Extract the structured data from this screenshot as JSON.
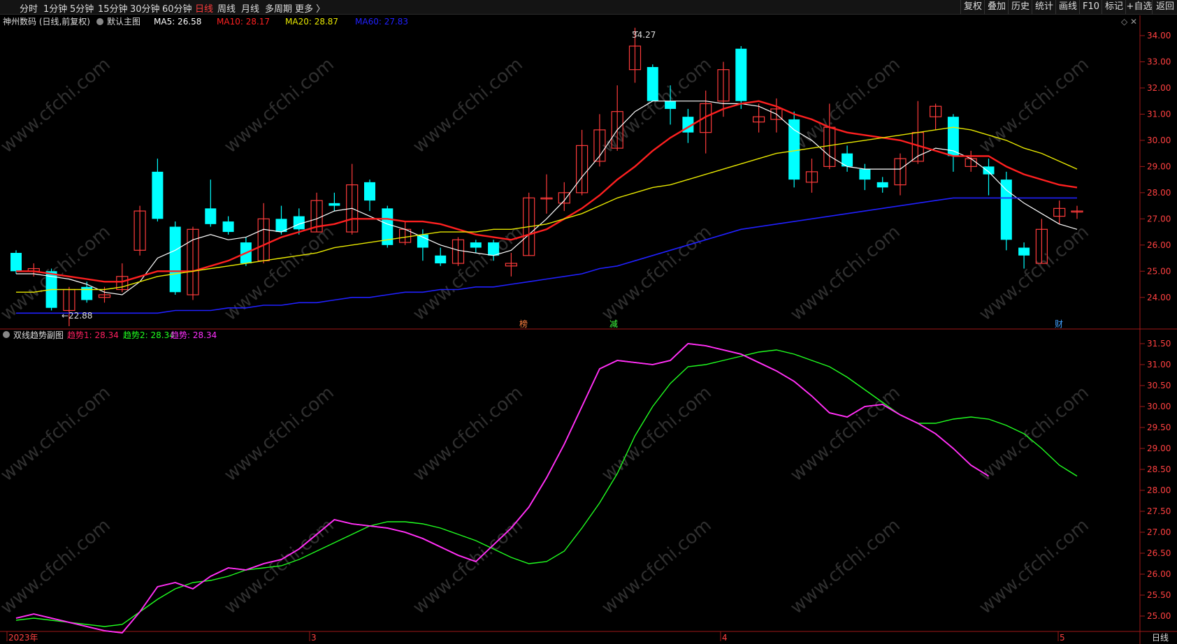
{
  "topbar": {
    "left_items": [
      "分时",
      "1分钟",
      "5分钟",
      "15分钟",
      "30分钟",
      "60分钟",
      "日线",
      "周线",
      "月线",
      "多周期",
      "更多 〉"
    ],
    "active": "日线",
    "right_items": [
      "复权",
      "叠加",
      "历史",
      "统计",
      "画线",
      "F10",
      "标记",
      "+自选",
      "返回"
    ]
  },
  "main_header": {
    "stock": "神州数码 (日线,前复权)",
    "indicator": "默认主图",
    "ma5": "MA5: 26.58",
    "ma10": "MA10: 28.17",
    "ma20": "MA20: 28.87",
    "ma60": "MA60: 27.83"
  },
  "sub_header": {
    "name": "双线趋势副图",
    "t1": "趋势1: 28.34",
    "t2": "趋势2: 28.34",
    "t3": "趋势: 28.34"
  },
  "annotations": {
    "high": "34.27",
    "low": "22.88",
    "markers": [
      "榜",
      "减",
      "财"
    ]
  },
  "date_labels": [
    "2023年",
    "3",
    "4",
    "5"
  ],
  "period_label": "日线",
  "watermark": "www.cfchi.com",
  "colors": {
    "up": "#ff3b3b",
    "down": "#00ffff",
    "ma5": "#ffffff",
    "ma10": "#ff2020",
    "ma20": "#e8e800",
    "ma60": "#2020ff",
    "trend1": "#ff2060",
    "trend2": "#20ff20",
    "trend": "#ff30ff"
  },
  "chart_data": [
    {
      "type": "candlestick",
      "title": "神州数码 (日线,前复权)",
      "ylim": [
        23.3,
        34.4
      ],
      "yticks": [
        24.0,
        25.0,
        26.0,
        27.0,
        28.0,
        29.0,
        30.0,
        31.0,
        32.0,
        33.0,
        34.0
      ],
      "candles": [
        [
          25.7,
          25.0,
          25.8,
          24.9
        ],
        [
          25.0,
          25.1,
          25.3,
          24.8
        ],
        [
          25.0,
          23.6,
          25.1,
          23.5
        ],
        [
          23.5,
          24.3,
          24.4,
          22.9
        ],
        [
          24.4,
          23.9,
          24.6,
          23.8
        ],
        [
          24.0,
          24.1,
          24.4,
          23.8
        ],
        [
          24.3,
          24.8,
          25.3,
          24.2
        ],
        [
          25.8,
          27.3,
          27.5,
          25.6
        ],
        [
          28.8,
          27.0,
          29.3,
          26.9
        ],
        [
          26.7,
          24.2,
          26.9,
          24.1
        ],
        [
          24.1,
          26.6,
          26.7,
          23.9
        ],
        [
          27.4,
          26.8,
          28.5,
          26.7
        ],
        [
          26.9,
          26.5,
          27.1,
          26.4
        ],
        [
          26.1,
          25.3,
          26.3,
          25.2
        ],
        [
          25.4,
          27.0,
          27.6,
          25.3
        ],
        [
          27.0,
          26.5,
          27.5,
          26.4
        ],
        [
          27.1,
          26.6,
          27.4,
          26.4
        ],
        [
          26.5,
          27.7,
          28.0,
          26.5
        ],
        [
          27.6,
          27.5,
          28.0,
          27.3
        ],
        [
          26.5,
          28.3,
          29.1,
          26.4
        ],
        [
          28.4,
          27.7,
          28.5,
          27.3
        ],
        [
          27.4,
          26.0,
          27.5,
          25.9
        ],
        [
          26.1,
          26.6,
          26.9,
          26.0
        ],
        [
          26.4,
          25.9,
          26.6,
          25.4
        ],
        [
          25.6,
          25.3,
          25.9,
          25.2
        ],
        [
          25.3,
          26.2,
          26.3,
          25.2
        ],
        [
          26.1,
          25.9,
          26.2,
          25.7
        ],
        [
          26.1,
          25.6,
          26.2,
          25.4
        ],
        [
          25.2,
          25.3,
          25.7,
          24.8
        ],
        [
          25.6,
          27.8,
          28.0,
          25.6
        ],
        [
          27.8,
          27.8,
          28.7,
          27.2
        ],
        [
          27.6,
          28.0,
          28.4,
          27.3
        ],
        [
          28.0,
          29.8,
          30.4,
          27.9
        ],
        [
          29.2,
          30.4,
          31.0,
          29.0
        ],
        [
          29.7,
          31.1,
          32.1,
          29.6
        ],
        [
          32.7,
          33.6,
          34.3,
          32.2
        ],
        [
          32.8,
          31.5,
          32.9,
          31.5
        ],
        [
          31.5,
          31.2,
          32.1,
          30.6
        ],
        [
          30.9,
          30.3,
          31.2,
          29.9
        ],
        [
          30.3,
          31.4,
          31.9,
          29.5
        ],
        [
          31.5,
          32.7,
          33.0,
          30.9
        ],
        [
          33.5,
          31.5,
          33.6,
          31.2
        ],
        [
          30.7,
          30.9,
          31.4,
          30.3
        ],
        [
          30.8,
          31.2,
          31.6,
          30.3
        ],
        [
          30.8,
          28.5,
          31.1,
          28.2
        ],
        [
          28.4,
          28.8,
          29.3,
          28.0
        ],
        [
          29.0,
          30.5,
          31.4,
          28.9
        ],
        [
          29.5,
          29.0,
          29.8,
          28.8
        ],
        [
          28.9,
          28.5,
          29.1,
          28.1
        ],
        [
          28.4,
          28.2,
          28.6,
          28.0
        ],
        [
          28.3,
          29.3,
          29.5,
          27.9
        ],
        [
          29.2,
          30.3,
          31.5,
          29.1
        ],
        [
          30.9,
          31.3,
          31.4,
          30.4
        ],
        [
          30.9,
          29.4,
          31.0,
          28.8
        ],
        [
          29.0,
          29.3,
          29.6,
          28.8
        ],
        [
          29.0,
          28.7,
          29.3,
          27.9
        ],
        [
          28.5,
          26.2,
          28.8,
          25.8
        ],
        [
          25.9,
          25.6,
          26.1,
          25.1
        ],
        [
          25.3,
          26.6,
          27.0,
          25.3
        ],
        [
          27.1,
          27.4,
          27.7,
          26.8
        ],
        [
          27.3,
          27.3,
          27.5,
          27.0
        ]
      ],
      "series": [
        {
          "name": "MA5",
          "values": [
            24.9,
            24.9,
            24.8,
            24.7,
            24.5,
            24.2,
            24.1,
            24.6,
            25.5,
            25.8,
            26.2,
            26.4,
            26.2,
            26.3,
            26.6,
            26.5,
            26.8,
            27.0,
            27.3,
            27.4,
            27.1,
            26.8,
            26.6,
            26.3,
            26.0,
            25.8,
            25.7,
            25.6,
            25.8,
            26.4,
            27.0,
            27.7,
            28.6,
            29.4,
            30.4,
            31.1,
            31.5,
            31.5,
            31.5,
            31.5,
            31.4,
            31.4,
            31.3,
            31.0,
            30.4,
            30.0,
            29.4,
            29.0,
            28.9,
            28.9,
            28.9,
            29.4,
            29.7,
            29.6,
            29.3,
            28.8,
            28.1,
            27.6,
            27.2,
            26.8,
            26.6
          ]
        },
        {
          "name": "MA10",
          "values": [
            25.0,
            25.0,
            24.9,
            24.8,
            24.7,
            24.6,
            24.6,
            24.8,
            25.0,
            25.0,
            25.0,
            25.2,
            25.4,
            25.7,
            26.0,
            26.3,
            26.5,
            26.7,
            26.8,
            27.0,
            27.0,
            27.0,
            26.9,
            26.9,
            26.8,
            26.6,
            26.4,
            26.3,
            26.2,
            26.4,
            26.6,
            27.0,
            27.4,
            27.9,
            28.5,
            29.0,
            29.6,
            30.1,
            30.5,
            30.9,
            31.2,
            31.4,
            31.5,
            31.3,
            31.0,
            30.8,
            30.5,
            30.3,
            30.2,
            30.1,
            30.0,
            29.8,
            29.6,
            29.4,
            29.4,
            29.4,
            29.0,
            28.7,
            28.5,
            28.3,
            28.2
          ]
        },
        {
          "name": "MA20",
          "values": [
            24.2,
            24.2,
            24.3,
            24.3,
            24.3,
            24.3,
            24.4,
            24.6,
            24.8,
            24.9,
            25.0,
            25.1,
            25.2,
            25.3,
            25.4,
            25.5,
            25.6,
            25.7,
            25.9,
            26.0,
            26.1,
            26.2,
            26.3,
            26.4,
            26.5,
            26.5,
            26.5,
            26.6,
            26.6,
            26.7,
            26.8,
            27.0,
            27.2,
            27.5,
            27.8,
            28.0,
            28.2,
            28.3,
            28.5,
            28.7,
            28.9,
            29.1,
            29.3,
            29.5,
            29.6,
            29.7,
            29.8,
            29.9,
            30.0,
            30.1,
            30.2,
            30.3,
            30.4,
            30.5,
            30.4,
            30.2,
            30.0,
            29.7,
            29.5,
            29.2,
            28.9
          ]
        },
        {
          "name": "MA60",
          "values": [
            23.4,
            23.4,
            23.4,
            23.4,
            23.4,
            23.4,
            23.4,
            23.4,
            23.4,
            23.5,
            23.5,
            23.5,
            23.6,
            23.6,
            23.7,
            23.7,
            23.8,
            23.8,
            23.9,
            24.0,
            24.0,
            24.1,
            24.2,
            24.2,
            24.3,
            24.3,
            24.4,
            24.4,
            24.5,
            24.6,
            24.7,
            24.8,
            24.9,
            25.1,
            25.2,
            25.4,
            25.6,
            25.8,
            26.0,
            26.2,
            26.4,
            26.6,
            26.7,
            26.8,
            26.9,
            27.0,
            27.1,
            27.2,
            27.3,
            27.4,
            27.5,
            27.6,
            27.7,
            27.8,
            27.8,
            27.8,
            27.8,
            27.8,
            27.8,
            27.8,
            27.8
          ]
        }
      ]
    },
    {
      "type": "line",
      "title": "双线趋势副图",
      "ylim": [
        24.7,
        31.7
      ],
      "yticks": [
        25.0,
        25.5,
        26.0,
        26.5,
        27.0,
        27.5,
        28.0,
        28.5,
        29.0,
        29.5,
        30.0,
        30.5,
        31.0,
        31.5
      ],
      "series": [
        {
          "name": "趋势2",
          "values": [
            24.9,
            24.95,
            24.9,
            24.85,
            24.8,
            24.75,
            24.8,
            25.1,
            25.4,
            25.65,
            25.8,
            25.85,
            25.95,
            26.1,
            26.15,
            26.2,
            26.35,
            26.55,
            26.75,
            26.95,
            27.15,
            27.25,
            27.25,
            27.2,
            27.1,
            26.95,
            26.8,
            26.6,
            26.4,
            26.25,
            26.3,
            26.55,
            27.1,
            27.7,
            28.4,
            29.3,
            30.0,
            30.55,
            30.95,
            31.0,
            31.1,
            31.2,
            31.3,
            31.35,
            31.25,
            31.1,
            30.95,
            30.7,
            30.4,
            30.1,
            29.8,
            29.6,
            29.6,
            29.7,
            29.75,
            29.7,
            29.55,
            29.35,
            29.0,
            28.6,
            28.34
          ]
        },
        {
          "name": "趋势1",
          "values": [
            24.95,
            25.05,
            24.95,
            24.85,
            24.75,
            24.65,
            24.6,
            25.1,
            25.7,
            25.8,
            25.65,
            25.95,
            26.15,
            26.1,
            26.25,
            26.35,
            26.6,
            26.95,
            27.3,
            27.2,
            27.15,
            27.1,
            27.0,
            26.85,
            26.65,
            26.45,
            26.3,
            26.7,
            27.1,
            27.6,
            28.3,
            29.1,
            30.0,
            30.9,
            31.1,
            31.05,
            31.0,
            31.1,
            31.5,
            31.45,
            31.35,
            31.25,
            31.05,
            30.85,
            30.6,
            30.25,
            29.85,
            29.75,
            30.0,
            30.05,
            29.8,
            29.6,
            29.35,
            29.0,
            28.6,
            28.34
          ]
        },
        {
          "name": "趋势",
          "values": [
            24.95,
            25.05,
            24.95,
            24.85,
            24.75,
            24.65,
            24.6,
            25.1,
            25.7,
            25.8,
            25.65,
            25.95,
            26.15,
            26.1,
            26.25,
            26.35,
            26.6,
            26.95,
            27.3,
            27.2,
            27.15,
            27.1,
            27.0,
            26.85,
            26.65,
            26.45,
            26.3,
            26.7,
            27.1,
            27.6,
            28.3,
            29.1,
            30.0,
            30.9,
            31.1,
            31.05,
            31.0,
            31.1,
            31.5,
            31.45,
            31.35,
            31.25,
            31.05,
            30.85,
            30.6,
            30.25,
            29.85,
            29.75,
            30.0,
            30.05,
            29.8,
            29.6,
            29.35,
            29.0,
            28.6,
            28.34
          ]
        }
      ]
    }
  ]
}
